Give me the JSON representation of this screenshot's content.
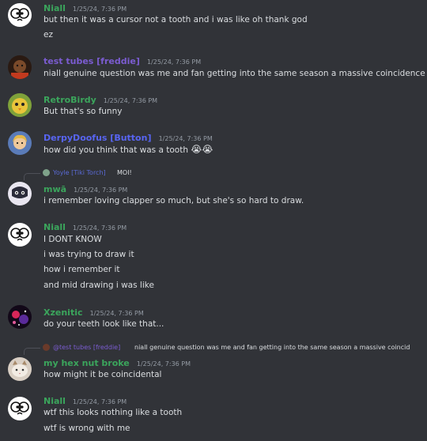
{
  "colors": {
    "background": "#313338",
    "niall": "#3ba55c",
    "test_tubes": "#7b5cd1",
    "retrobirdy": "#3ba55c",
    "derpydoofus": "#5865f2",
    "mwa": "#3ba55c",
    "xzenitic": "#3ba55c",
    "hexnut": "#3ba55c",
    "yoyle": "#5a6ad6",
    "timestamp": "#949ba4",
    "text": "#dbdee1"
  },
  "messages": [
    {
      "username": "Niall",
      "timestamp": "1/25/24, 7:36 PM",
      "lines": [
        "but then it was a cursor not a tooth and i was like oh thank god",
        "ez"
      ]
    },
    {
      "username": "test tubes [freddie]",
      "timestamp": "1/25/24, 7:36 PM",
      "lines": [
        "niall genuine question was me and fan getting into the same season a massive coincidence LOL"
      ]
    },
    {
      "username": "RetroBirdy",
      "timestamp": "1/25/24, 7:36 PM",
      "lines": [
        "But that's so funny"
      ]
    },
    {
      "username": "DerpyDoofus [Button]",
      "timestamp": "1/25/24, 7:36 PM",
      "lines": [
        "how did you think that was a tooth",
        "😭😭"
      ]
    },
    {
      "reply_username": "Yoyle [Tiki Torch]",
      "reply_text": "MOI!",
      "username": "mwā",
      "timestamp": "1/25/24, 7:36 PM",
      "lines": [
        "i remember loving clapper so much, but she's so hard to draw."
      ]
    },
    {
      "username": "Niall",
      "timestamp": "1/25/24, 7:36 PM",
      "lines": [
        "I DONT KNOW",
        "i was trying to draw it",
        "how i remember it",
        "and mid drawing i was like"
      ]
    },
    {
      "username": "Xzenitic",
      "timestamp": "1/25/24, 7:36 PM",
      "lines": [
        "do your teeth look like that..."
      ]
    },
    {
      "reply_username": "@test tubes [freddie]",
      "reply_text": "niall genuine question was me and fan getting into the same season a massive coincid",
      "username": "my hex nut broke",
      "timestamp": "1/25/24, 7:36 PM",
      "lines": [
        "how might it be coincidental"
      ]
    },
    {
      "username": "Niall",
      "timestamp": "1/25/24, 7:36 PM",
      "lines": [
        "wtf this looks nothing like a tooth",
        "wtf is wrong with me"
      ]
    }
  ],
  "avatars": [
    "owl-face-icon",
    "dark-portrait-icon",
    "yellow-bird-icon",
    "blonde-portrait-icon",
    "mask-face-icon",
    "owl-face-icon",
    "galaxy-icon",
    "cat-icon",
    "owl-face-icon"
  ]
}
